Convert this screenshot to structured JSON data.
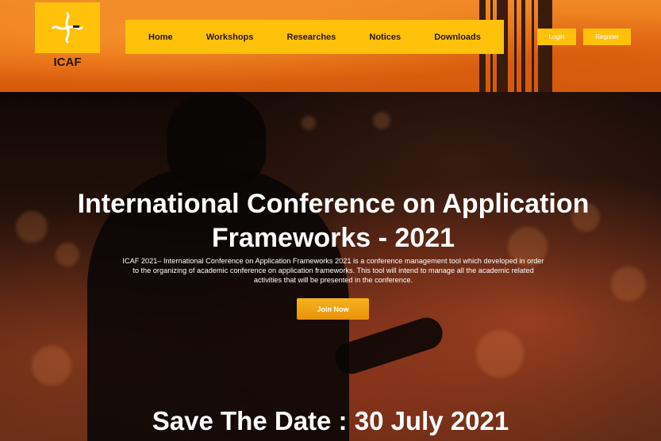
{
  "header": {
    "logo_text": "ICAF",
    "nav": [
      "Home",
      "Workshops",
      "Researches",
      "Notices",
      "Downloads"
    ],
    "login_label": "Login",
    "register_label": "Register"
  },
  "hero": {
    "title_line1": "International Conference on Application",
    "title_line2": "Frameworks - 2021",
    "description": "ICAF 2021– International Conference on Application Frameworks 2021 is a conference management tool which developed in order to the organizing of academic conference on application frameworks. This tool will intend to manage all the academic related activities that will be presented in the conference.",
    "join_label": "Join Now",
    "save_date": "Save The Date : 30 July 2021"
  },
  "colors": {
    "accent": "#ffc10a",
    "header_orange": "#e86f14",
    "button_orange": "#f6b21c"
  }
}
